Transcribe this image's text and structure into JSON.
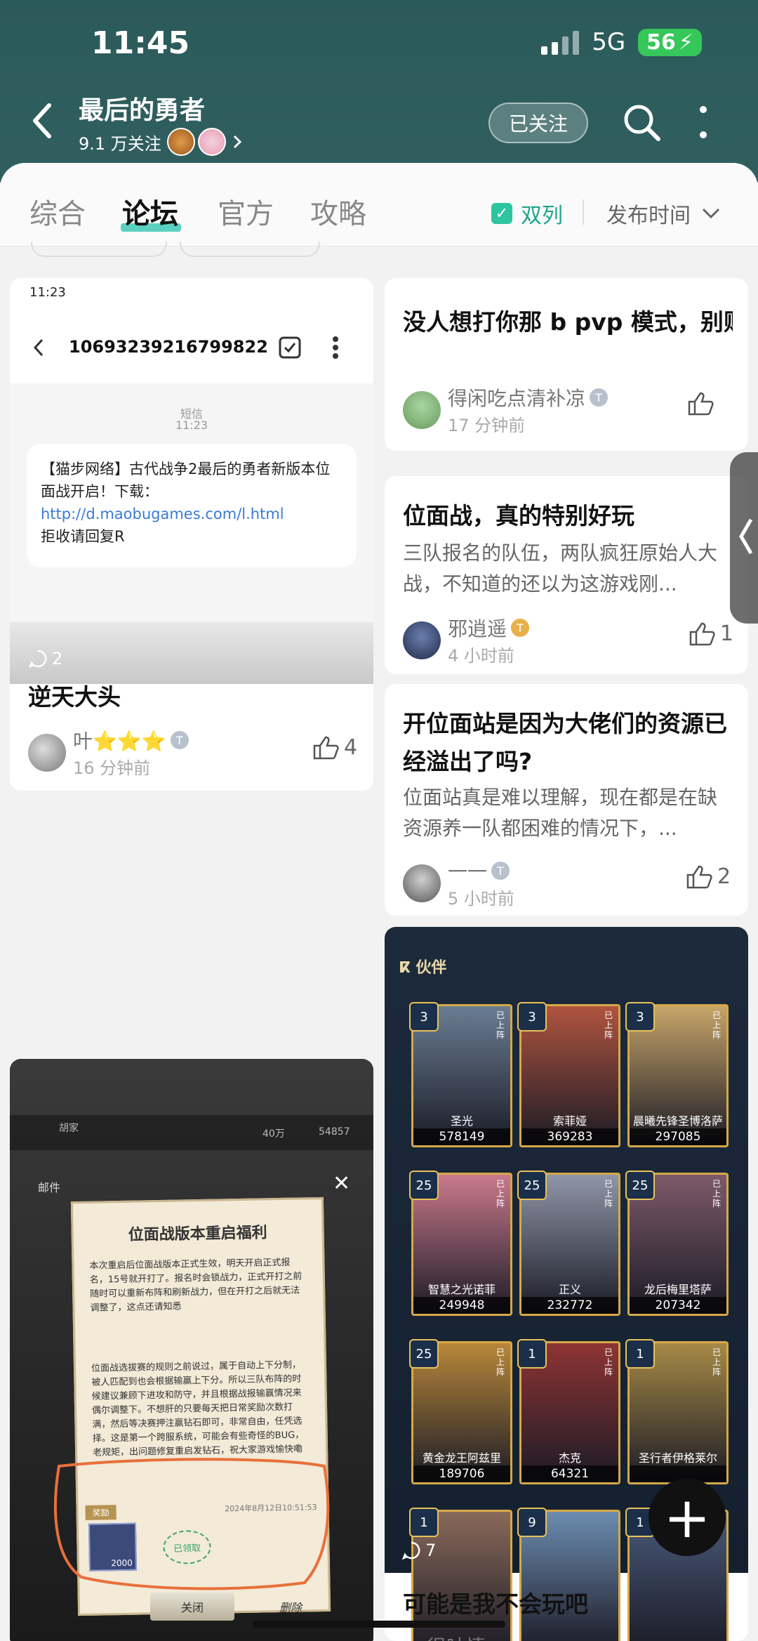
{
  "status": {
    "time": "11:45",
    "network": "5G",
    "battery": "56"
  },
  "header": {
    "title": "最后的勇者",
    "followers": "9.1 万关注",
    "follow_label": "已关注"
  },
  "tabs": [
    {
      "label": "综合",
      "active": false
    },
    {
      "label": "论坛",
      "active": true
    },
    {
      "label": "官方",
      "active": false
    },
    {
      "label": "攻略",
      "active": false
    }
  ],
  "toolbar": {
    "dual_label": "双列",
    "sort_label": "发布时间"
  },
  "left_col": {
    "card1": {
      "sms": {
        "status_time": "11:23",
        "sender": "10693239216799822",
        "meta_label": "短信",
        "meta_time": "11:23",
        "body_1": "【猫步网络】古代战争2最后的勇者新版本位面战开启！下载：",
        "link": "http://d.maobugames.com/l.html",
        "body_2": " 拒收请回复R"
      },
      "comments": "2",
      "title": "逆天大头",
      "author": "叶⭐⭐⭐",
      "time": "16 分钟前",
      "likes": "4"
    },
    "card2": {
      "game_header": {
        "left": "胡家",
        "right": "40万",
        "far": "54857"
      },
      "mail_tab": "邮件",
      "notice_title": "位面战版本重启福利",
      "notice_p1": "本次重启后位面战版本正式生效，明天开启正式报名，15号就开打了。报名时会锁战力，正式开打之前随时可以重新布阵和刷新战力，但在开打之后就无法调整了，这点还请知悉",
      "notice_p2": "位面战选拔赛的规则之前说过，属于自动上下分制，被人匹配到也会根据输赢上下分。所以三队布阵的时候建议兼顾下进攻和防守，并且根据战报输赢情况来偶尔调整下。不想肝的只要每天把日常奖励次数打满，然后等决赛押注赢钻石即可，非常自由，任凭选择。这是第一个跨服系统，可能会有些奇怪的BUG，老规矩，出问题修复重启发钻石，祝大家游戏愉快嘞",
      "reward_label": "奖励",
      "date": "2024年8月12日10:51:53",
      "gem_count": "2000",
      "claimed": "已领取",
      "close": "关闭",
      "delete": "删除"
    }
  },
  "right_col": {
    "post1": {
      "title": "没人想打你那 b pvp 模式，别败坏一代留下的口碑了",
      "author": "得闲吃点清补凉",
      "time": "17 分钟前"
    },
    "post2": {
      "title": "位面战，真的特别好玩",
      "body": "三队报名的队伍，两队疯狂原始人大战，不知道的还以为这游戏刚...",
      "author": "邪逍遥",
      "time": "4 小时前",
      "likes": "1"
    },
    "post3": {
      "title": "开位面站是因为大佬们的资源已经溢出了吗?",
      "body": "位面站真是难以理解，现在都是在缺资源养一队都困难的情况下，...",
      "author": "一一",
      "time": "5 小时前",
      "likes": "2"
    },
    "post4": {
      "panel_title": "伙伴",
      "on_field": "已上阵",
      "heroes": [
        {
          "level": "3",
          "name": "圣光",
          "power": "578149",
          "color": "#6a7d93"
        },
        {
          "level": "3",
          "name": "索菲娅",
          "power": "369283",
          "color": "#b0543f"
        },
        {
          "level": "3",
          "name": "晨曦先锋圣博洛萨",
          "power": "297085",
          "color": "#c7a469"
        },
        {
          "level": "25",
          "name": "智慧之光诺菲",
          "power": "249948",
          "color": "#c9798c"
        },
        {
          "level": "25",
          "name": "正义",
          "power": "232772",
          "color": "#8f96a8"
        },
        {
          "level": "25",
          "name": "龙后梅里塔萨",
          "power": "207342",
          "color": "#7d5a6a"
        },
        {
          "level": "25",
          "name": "黄金龙王阿兹里",
          "power": "189706",
          "color": "#b8873a"
        },
        {
          "level": "1",
          "name": "杰克",
          "power": "64321",
          "color": "#8e3434"
        },
        {
          "level": "1",
          "name": "圣行者伊格莱尔",
          "power": "",
          "color": "#a68a46"
        },
        {
          "level": "1",
          "name": "",
          "power": "",
          "color": "#8a6a5a"
        },
        {
          "level": "9",
          "name": "",
          "power": "",
          "color": "#6c8cb0"
        },
        {
          "level": "1",
          "name": "",
          "power": "",
          "color": "#4a5a7a"
        }
      ],
      "comments": "7",
      "title": "可能是我不会玩吧",
      "author": "很呐情"
    }
  },
  "colors": {
    "header": "#2d5c5c",
    "accent": "#2ec4a0",
    "tab_underline": "#5ad1c0"
  }
}
